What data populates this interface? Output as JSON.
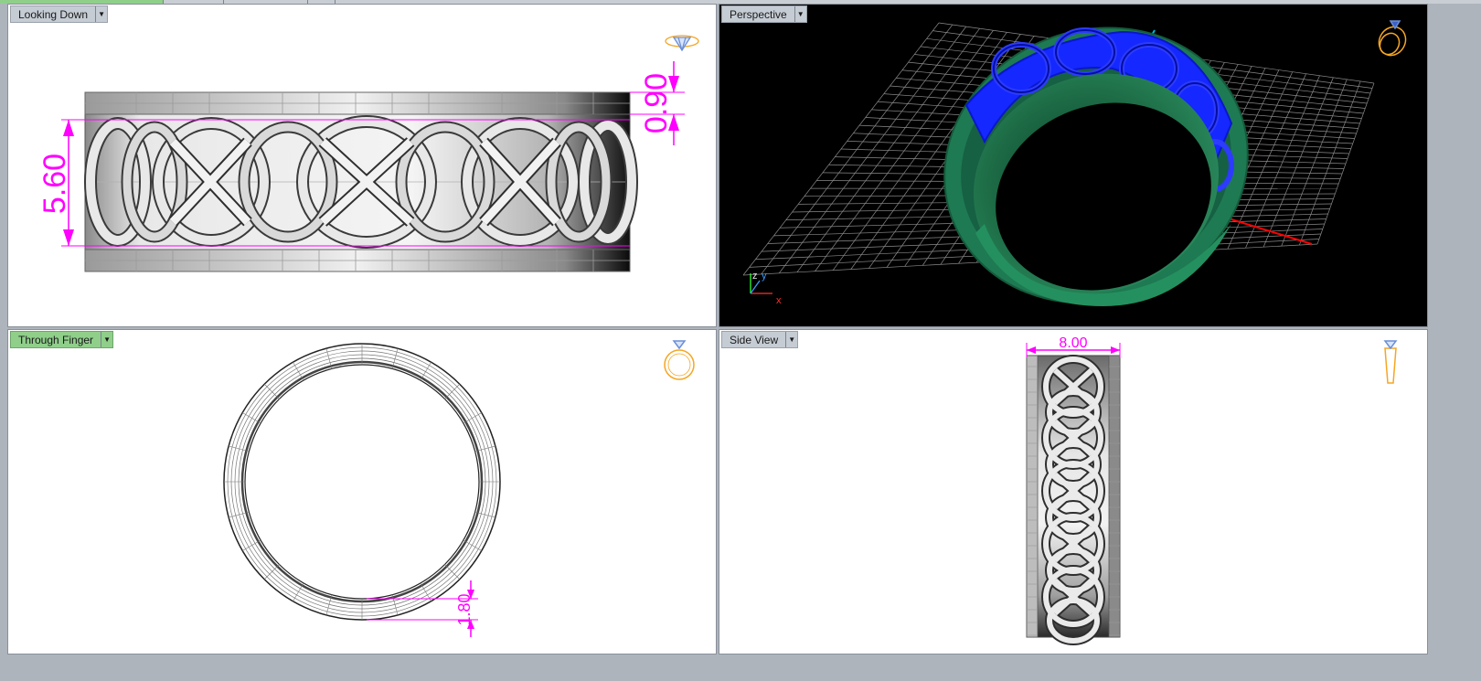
{
  "viewports": {
    "top": {
      "label": "Looking Down"
    },
    "perspective": {
      "label": "Perspective"
    },
    "front": {
      "label": "Through Finger"
    },
    "side": {
      "label": "Side View"
    }
  },
  "dimensions": {
    "height_left": "5.60",
    "height_right": "0.90",
    "thickness": "1.80",
    "width": "8.00"
  },
  "axis_labels": {
    "z": "z",
    "y": "y",
    "x": "x"
  },
  "icons": {
    "dropdown": "dropdown-arrow-icon",
    "top_gizmo": "ring-top-gizmo-icon",
    "persp_gizmo": "ring-perspective-gizmo-icon",
    "front_gizmo": "ring-front-gizmo-icon",
    "side_gizmo": "ring-side-gizmo-icon"
  },
  "colors": {
    "dimension": "#ff00ff",
    "ring_green": "#1f7a52",
    "pattern_blue": "#1428ff",
    "gizmo_orange": "#f5a623",
    "active_tab": "#8fcf8a"
  }
}
